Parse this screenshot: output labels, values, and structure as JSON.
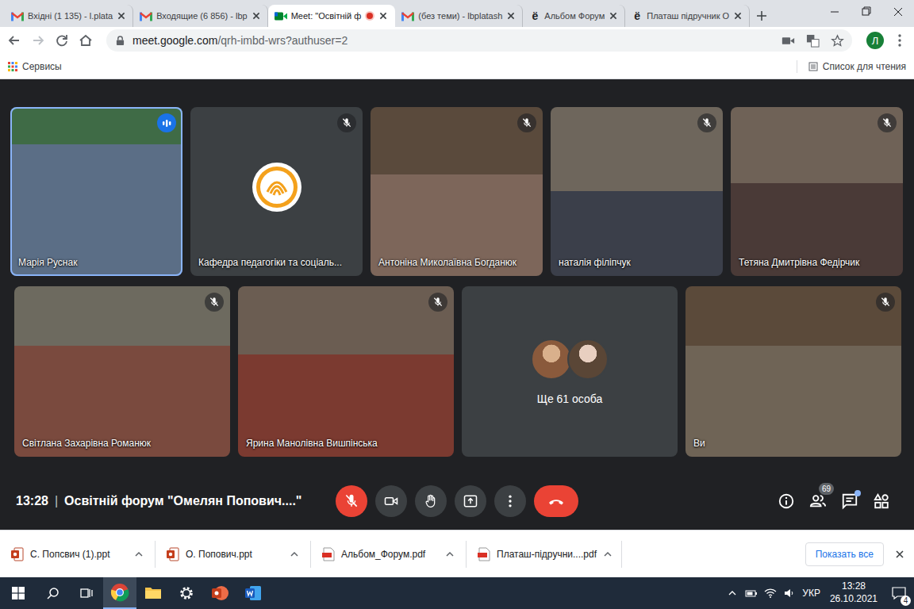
{
  "tabs": [
    {
      "kind": "gmail",
      "label": "Вхідні (1 135) - l.plata",
      "selected": false,
      "recording": false,
      "glyph": ""
    },
    {
      "kind": "gmail",
      "label": "Входящие (6 856) - lbp",
      "selected": false,
      "recording": false,
      "glyph": ""
    },
    {
      "kind": "meet",
      "label": "Meet: \"Освітній ф",
      "selected": true,
      "recording": true,
      "glyph": ""
    },
    {
      "kind": "gmail",
      "label": "(без теми) - lbplatash",
      "selected": false,
      "recording": false,
      "glyph": ""
    },
    {
      "kind": "doc",
      "label": "Альбом Форум",
      "selected": false,
      "recording": false,
      "glyph": "ё"
    },
    {
      "kind": "doc",
      "label": "Платаш підручник О",
      "selected": false,
      "recording": false,
      "glyph": "ё"
    }
  ],
  "address": {
    "host": "meet.google.com",
    "path": "/qrh-imbd-wrs?authuser=2"
  },
  "profile": "Л",
  "bookmarks": {
    "left": "Сервисы",
    "right": "Список для чтения"
  },
  "meet": {
    "participants": [
      {
        "kind": "video",
        "name": "Марія Руснак",
        "muted": false,
        "speaking": true,
        "selected": true
      },
      {
        "kind": "logo",
        "name": "Кафедра педагогіки та соціаль...",
        "muted": true,
        "speaking": false,
        "selected": false
      },
      {
        "kind": "video",
        "name": "Антоніна Миколаївна Богданюк",
        "muted": true,
        "speaking": false,
        "selected": false
      },
      {
        "kind": "video",
        "name": "наталія філіпчук",
        "muted": true,
        "speaking": false,
        "selected": false
      },
      {
        "kind": "video",
        "name": "Тетяна Дмитрівна Федірчик",
        "muted": true,
        "speaking": false,
        "selected": false
      },
      {
        "kind": "video",
        "name": "Світлана Захарівна Романюк",
        "muted": true,
        "speaking": false,
        "selected": false
      },
      {
        "kind": "video",
        "name": "Ярина Манолівна Вишпінська",
        "muted": true,
        "speaking": false,
        "selected": false
      },
      {
        "kind": "others",
        "name": "Ще 61 особа",
        "muted": false,
        "speaking": false,
        "selected": false
      },
      {
        "kind": "video",
        "name": "Ви",
        "muted": true,
        "speaking": false,
        "selected": false
      }
    ],
    "time": "13:28",
    "separator": "|",
    "title": "Освітній форум \"Омелян Попович....\"",
    "mic_on": false,
    "camera_on": false,
    "people_count": "69",
    "chat_unread": true
  },
  "downloads": {
    "items": [
      {
        "kind": "ppt",
        "name": "С. Попсвич (1).ppt"
      },
      {
        "kind": "ppt",
        "name": "О. Попович.ppt"
      },
      {
        "kind": "pdf",
        "name": "Альбом_Форум.pdf"
      },
      {
        "kind": "pdf",
        "name": "Платаш-підручни....pdf"
      }
    ],
    "show_all": "Показать все"
  },
  "taskbar": {
    "language": "УКР",
    "time": "13:28",
    "date": "26.10.2021",
    "notifications": "4"
  }
}
